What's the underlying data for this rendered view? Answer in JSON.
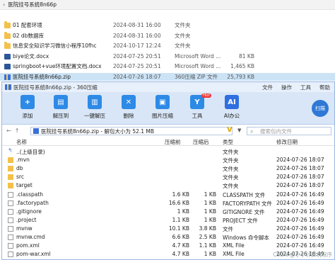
{
  "explorer": {
    "path": "医院挂号系统8n66p",
    "files": [
      {
        "name": "01 配套环境",
        "date": "2024-08-31 16:00",
        "type": "文件夹",
        "size": "",
        "icon": "folder-icon"
      },
      {
        "name": "02 db数据库",
        "date": "2024-08-31 16:00",
        "type": "文件夹",
        "size": "",
        "icon": "folder-icon"
      },
      {
        "name": "信息安全知识学习微信小程序10fhc",
        "date": "2024-10-17 12:24",
        "type": "文件夹",
        "size": "",
        "icon": "folder-icon"
      },
      {
        "name": "biye论文.docx",
        "date": "2024-07-25 20:51",
        "type": "Microsoft Word ...",
        "size": "81 KB",
        "icon": "word-icon"
      },
      {
        "name": "springboot+vue环境配置文档.docx",
        "date": "2024-07-25 20:51",
        "type": "Microsoft Word ...",
        "size": "1,465 KB",
        "icon": "word-icon"
      },
      {
        "name": "医院挂号系统8n66p.zip",
        "date": "2024-07-26 18:07",
        "type": "360压缩 ZIP 文件",
        "size": "25,793 KB",
        "icon": "zip-icon",
        "selected": true
      }
    ]
  },
  "zip_window": {
    "title": "医院挂号系统8n66p.zip - 360压缩",
    "menu": [
      "文件",
      "操作",
      "工具",
      "帮助"
    ],
    "toolbar": [
      {
        "label": "添加",
        "icon": "add-icon",
        "color": "#2d8ae6",
        "glyph": "+"
      },
      {
        "label": "解压到",
        "icon": "extract-to-icon",
        "color": "#2d8ae6",
        "glyph": "▤"
      },
      {
        "label": "一键解压",
        "icon": "one-click-extract-icon",
        "color": "#2d8ae6",
        "glyph": "▥"
      },
      {
        "label": "删除",
        "icon": "delete-icon",
        "color": "#2d8ae6",
        "glyph": "✕"
      },
      {
        "label": "图片压缩",
        "icon": "image-compress-icon",
        "color": "#2d8ae6",
        "glyph": "▣"
      },
      {
        "label": "工具",
        "icon": "tools-icon",
        "color": "#2d8ae6",
        "glyph": "Y",
        "badge": "Hot"
      },
      {
        "label": "AI办公",
        "icon": "ai-office-icon",
        "color": "#2f6fe0",
        "glyph": "AI"
      }
    ],
    "scan_label": "扫描",
    "address": "医院挂号系统8n66p.zip - 解包大小为 52.1 MB",
    "search_placeholder": "搜索包内文件",
    "columns": [
      "名称",
      "压缩前",
      "压缩后",
      "类型",
      "修改日期"
    ],
    "entries": [
      {
        "name": "..(上级目录)",
        "before": "",
        "after": "",
        "type": "文件夹",
        "date": "",
        "icon": "up-icon"
      },
      {
        "name": ".mvn",
        "before": "",
        "after": "",
        "type": "文件夹",
        "date": "2024-07-26 18:07",
        "icon": "folder-icon"
      },
      {
        "name": "db",
        "before": "",
        "after": "",
        "type": "文件夹",
        "date": "2024-07-26 18:07",
        "icon": "folder-icon"
      },
      {
        "name": "src",
        "before": "",
        "after": "",
        "type": "文件夹",
        "date": "2024-07-26 18:07",
        "icon": "folder-icon"
      },
      {
        "name": "target",
        "before": "",
        "after": "",
        "type": "文件夹",
        "date": "2024-07-26 18:07",
        "icon": "folder-icon"
      },
      {
        "name": ".classpath",
        "before": "1.6 KB",
        "after": "1 KB",
        "type": "CLASSPATH 文件",
        "date": "2024-07-26 16:49",
        "icon": "file-icon"
      },
      {
        "name": ".factorypath",
        "before": "16.6 KB",
        "after": "1 KB",
        "type": "FACTORYPATH 文件",
        "date": "2024-07-26 16:49",
        "icon": "file-icon"
      },
      {
        "name": ".gitignore",
        "before": "1 KB",
        "after": "1 KB",
        "type": "GITIGNORE 文件",
        "date": "2024-07-26 16:49",
        "icon": "file-icon"
      },
      {
        "name": ".project",
        "before": "1.1 KB",
        "after": "1 KB",
        "type": "PROJECT 文件",
        "date": "2024-07-26 16:49",
        "icon": "file-icon"
      },
      {
        "name": "mvnw",
        "before": "10.1 KB",
        "after": "3.8 KB",
        "type": "文件",
        "date": "2024-07-26 16:49",
        "icon": "file-icon"
      },
      {
        "name": "mvnw.cmd",
        "before": "6.6 KB",
        "after": "2.5 KB",
        "type": "Windows 命令脚本",
        "date": "2024-07-26 16:49",
        "icon": "file-icon"
      },
      {
        "name": "pom.xml",
        "before": "4.7 KB",
        "after": "1.1 KB",
        "type": "XML File",
        "date": "2024-07-26 16:49",
        "icon": "file-icon"
      },
      {
        "name": "pom-war.xml",
        "before": "4.7 KB",
        "after": "1 KB",
        "type": "XML File",
        "date": "2024-07-26 16:49",
        "icon": "file-icon"
      }
    ]
  },
  "watermark": "CSDN @小小计算机程序"
}
